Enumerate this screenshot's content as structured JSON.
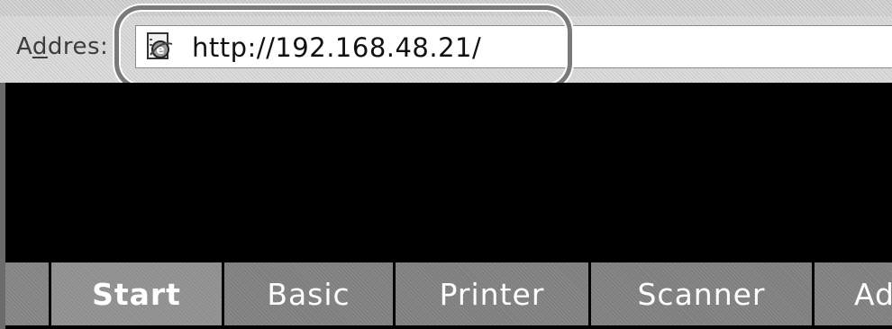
{
  "address_bar": {
    "label_prefix": "A",
    "label_accel": "d",
    "label_suffix": "dres:",
    "url": "http://192.168.48.21/",
    "page_icon": "ie-page-icon"
  },
  "tabs": [
    {
      "label": "Start",
      "active": true
    },
    {
      "label": "Basic",
      "active": false
    },
    {
      "label": "Printer",
      "active": false
    },
    {
      "label": "Scanner",
      "active": false
    },
    {
      "label": "Ad",
      "active": false
    }
  ],
  "colors": {
    "page_background": "#000000",
    "tab_background": "#7e7e7e",
    "highlight_ring": "#7a7a7a"
  }
}
